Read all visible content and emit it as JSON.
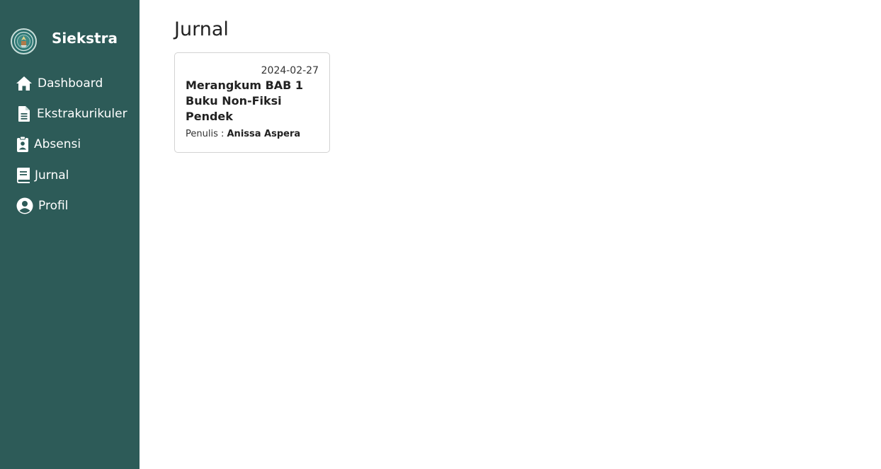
{
  "app": {
    "name": "Siekstra",
    "logo_icon": "school-emblem-icon"
  },
  "sidebar": {
    "background": "#2d5b58",
    "items": [
      {
        "label": "Dashboard",
        "icon": "home-icon"
      },
      {
        "label": "Ekstrakurikuler",
        "icon": "file-icon"
      },
      {
        "label": "Absensi",
        "icon": "clipboard-user-icon"
      },
      {
        "label": "Jurnal",
        "icon": "book-icon"
      },
      {
        "label": "Profil",
        "icon": "user-circle-icon"
      }
    ]
  },
  "main": {
    "title": "Jurnal",
    "cards": [
      {
        "date": "2024-02-27",
        "title": "Merangkum BAB 1 Buku Non-Fiksi Pendek",
        "author_label": "Penulis :",
        "author": "Anissa Aspera"
      }
    ]
  }
}
